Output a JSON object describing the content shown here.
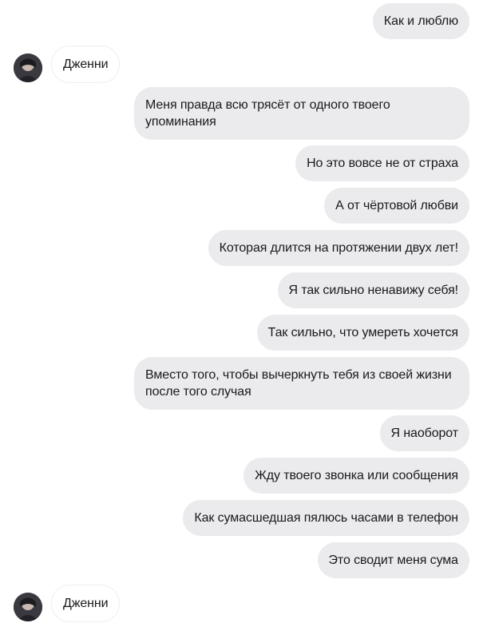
{
  "conversation": {
    "messages": [
      {
        "sender": "me",
        "text": "Как и люблю"
      },
      {
        "sender": "Дженни",
        "text": "Дженни"
      },
      {
        "sender": "me",
        "text": "Меня правда всю трясёт от одного твоего упоминания"
      },
      {
        "sender": "me",
        "text": "Но это вовсе не от страха"
      },
      {
        "sender": "me",
        "text": "А от чёртовой любви"
      },
      {
        "sender": "me",
        "text": "Которая длится на протяжении двух лет!"
      },
      {
        "sender": "me",
        "text": "Я так сильно ненавижу себя!"
      },
      {
        "sender": "me",
        "text": "Так сильно, что умереть хочется"
      },
      {
        "sender": "me",
        "text": "Вместо того, чтобы вычеркнуть тебя из своей жизни после того случая"
      },
      {
        "sender": "me",
        "text": "Я наоборот"
      },
      {
        "sender": "me",
        "text": "Жду твоего звонка или сообщения"
      },
      {
        "sender": "me",
        "text": "Как сумасшедшая пялюсь часами в телефон"
      },
      {
        "sender": "me",
        "text": "Это сводит меня сума"
      },
      {
        "sender": "Дженни",
        "text": "Дженни"
      }
    ]
  },
  "colors": {
    "outgoing_bubble": "#ebeaed",
    "incoming_bubble": "#ffffff",
    "text": "#1a1a1a"
  },
  "icons": {
    "avatar": "user-avatar-photo"
  }
}
